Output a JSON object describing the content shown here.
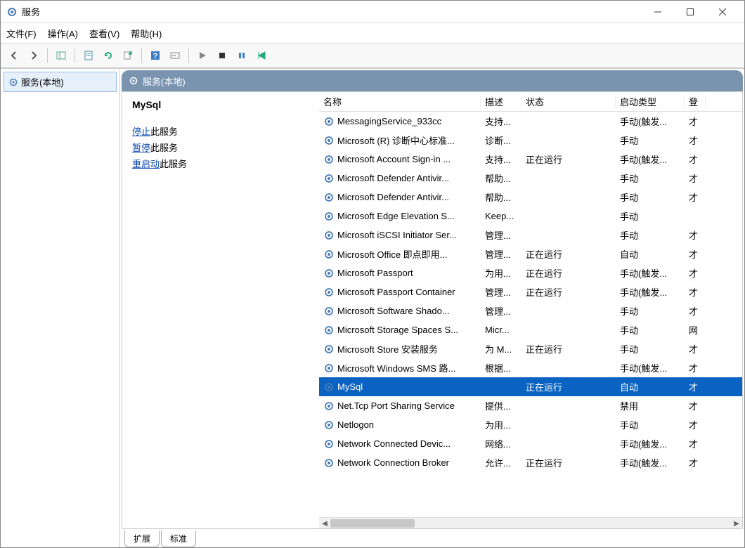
{
  "window": {
    "title": "服务"
  },
  "menubar": {
    "file": "文件(F)",
    "action": "操作(A)",
    "view": "查看(V)",
    "help": "帮助(H)"
  },
  "tree": {
    "root": "服务(本地)"
  },
  "pane": {
    "title": "服务(本地)"
  },
  "detail": {
    "selected_name": "MySql",
    "stop_link": "停止",
    "stop_suffix": "此服务",
    "pause_link": "暂停",
    "pause_suffix": "此服务",
    "restart_link": "重启动",
    "restart_suffix": "此服务"
  },
  "columns": {
    "name": "名称",
    "desc": "描述",
    "status": "状态",
    "startup": "启动类型",
    "logon": "登"
  },
  "services": [
    {
      "name": "MessagingService_933cc",
      "desc": "支持...",
      "status": "",
      "startup": "手动(触发...",
      "logon": "才"
    },
    {
      "name": "Microsoft (R) 诊断中心标准...",
      "desc": "诊断...",
      "status": "",
      "startup": "手动",
      "logon": "才"
    },
    {
      "name": "Microsoft Account Sign-in ...",
      "desc": "支持...",
      "status": "正在运行",
      "startup": "手动(触发...",
      "logon": "才"
    },
    {
      "name": "Microsoft Defender Antivir...",
      "desc": "帮助...",
      "status": "",
      "startup": "手动",
      "logon": "才"
    },
    {
      "name": "Microsoft Defender Antivir...",
      "desc": "帮助...",
      "status": "",
      "startup": "手动",
      "logon": "才"
    },
    {
      "name": "Microsoft Edge Elevation S...",
      "desc": "Keep...",
      "status": "",
      "startup": "手动",
      "logon": ""
    },
    {
      "name": "Microsoft iSCSI Initiator Ser...",
      "desc": "管理...",
      "status": "",
      "startup": "手动",
      "logon": "才"
    },
    {
      "name": "Microsoft Office 即点即用...",
      "desc": "管理...",
      "status": "正在运行",
      "startup": "自动",
      "logon": "才"
    },
    {
      "name": "Microsoft Passport",
      "desc": "为用...",
      "status": "正在运行",
      "startup": "手动(触发...",
      "logon": "才"
    },
    {
      "name": "Microsoft Passport Container",
      "desc": "管理...",
      "status": "正在运行",
      "startup": "手动(触发...",
      "logon": "才"
    },
    {
      "name": "Microsoft Software Shado...",
      "desc": "管理...",
      "status": "",
      "startup": "手动",
      "logon": "才"
    },
    {
      "name": "Microsoft Storage Spaces S...",
      "desc": "Micr...",
      "status": "",
      "startup": "手动",
      "logon": "网"
    },
    {
      "name": "Microsoft Store 安装服务",
      "desc": "为 M...",
      "status": "正在运行",
      "startup": "手动",
      "logon": "才"
    },
    {
      "name": "Microsoft Windows SMS 路...",
      "desc": "根据...",
      "status": "",
      "startup": "手动(触发...",
      "logon": "才"
    },
    {
      "name": "MySql",
      "desc": "",
      "status": "正在运行",
      "startup": "自动",
      "logon": "才",
      "selected": true
    },
    {
      "name": "Net.Tcp Port Sharing Service",
      "desc": "提供...",
      "status": "",
      "startup": "禁用",
      "logon": "才"
    },
    {
      "name": "Netlogon",
      "desc": "为用...",
      "status": "",
      "startup": "手动",
      "logon": "才"
    },
    {
      "name": "Network Connected Devic...",
      "desc": "网络...",
      "status": "",
      "startup": "手动(触发...",
      "logon": "才"
    },
    {
      "name": "Network Connection Broker",
      "desc": "允许...",
      "status": "正在运行",
      "startup": "手动(触发...",
      "logon": "才"
    }
  ],
  "tabs": {
    "extended": "扩展",
    "standard": "标准"
  }
}
